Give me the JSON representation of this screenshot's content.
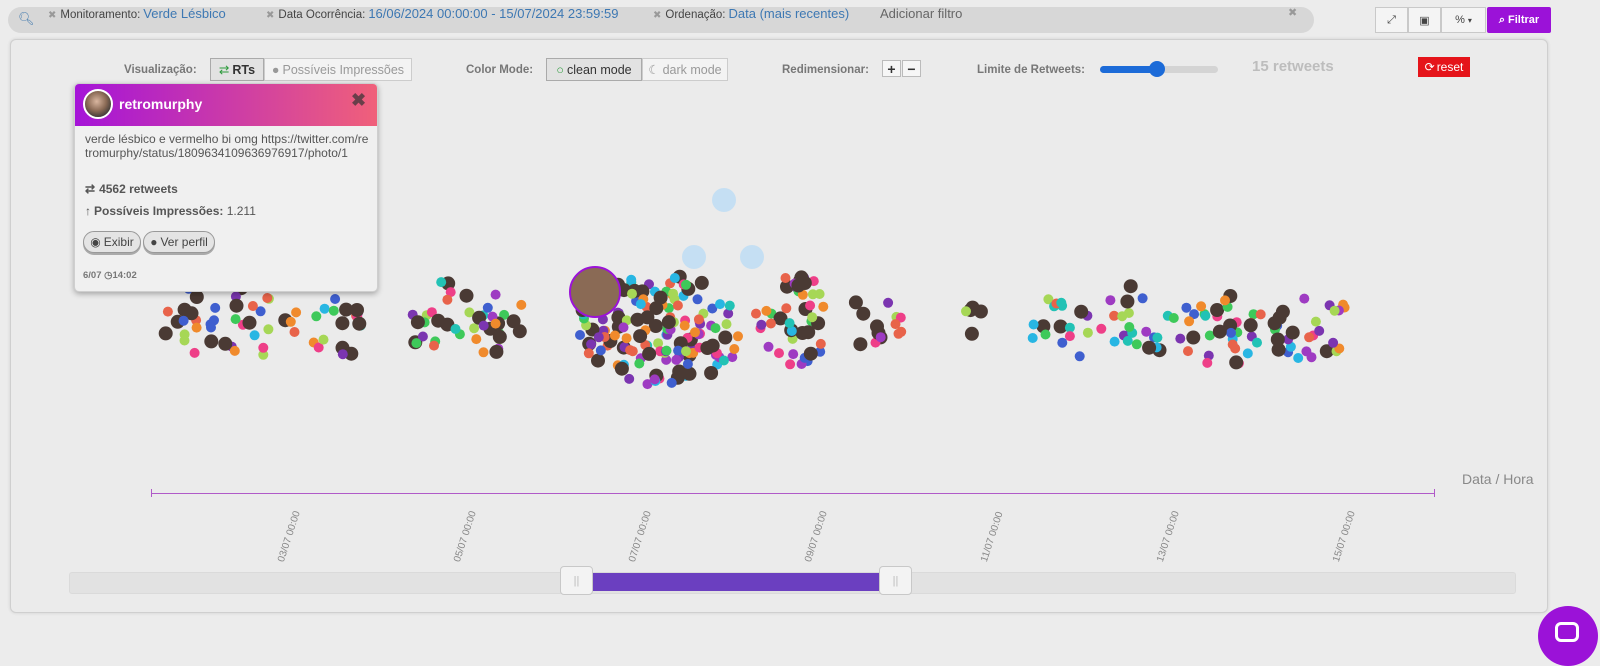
{
  "filters": {
    "search_icon": "search-icon",
    "chips": [
      {
        "label": "Monitoramento:",
        "value": "Verde Lésbico"
      },
      {
        "label": "Data Ocorrência:",
        "value": "16/06/2024 00:00:00 - 15/07/2024 23:59:59"
      },
      {
        "label": "Ordenação:",
        "value": "Data (mais recentes)"
      }
    ],
    "add_filter": "Adicionar filtro",
    "percent_label": "%",
    "filter_button": "Filtrar"
  },
  "controls": {
    "visualizacao_label": "Visualização:",
    "rts_label": "RTs",
    "impressoes_label": "Possíveis Impressões",
    "color_mode_label": "Color Mode:",
    "clean_mode": "clean mode",
    "dark_mode": "dark mode",
    "redimensionar_label": "Redimensionar:",
    "plus": "+",
    "minus": "−",
    "limite_label": "Limite de Retweets:",
    "limite_value_fraction": 0.5,
    "retweets_count": "15 retweets",
    "reset_label": "reset"
  },
  "popup": {
    "user": "retromurphy",
    "text": "verde lésbico e vermelho bi omg https://twitter.com/retromurphy/status/1809634109636976917/photo/1",
    "retweets": "4562 retweets",
    "impressoes_label": "Possíveis Impressões:",
    "impressoes_value": "1.211",
    "exibir": "Exibir",
    "ver_perfil": "Ver perfil",
    "date": "6/07",
    "time": "14:02"
  },
  "axis": {
    "label": "Data / Hora",
    "ticks": [
      "03/07 00:00",
      "05/07 00:00",
      "07/07 00:00",
      "09/07 00:00",
      "11/07 00:00",
      "13/07 00:00",
      "15/07 00:00"
    ]
  },
  "colors": {
    "accent": "#9b12d8",
    "reset": "#e5141a",
    "slider": "#1c6bd8",
    "range": "#6b3fc0",
    "bubble_palette": [
      "#7b35b0",
      "#e8634a",
      "#a6d756",
      "#22c2b5",
      "#3f5fcf",
      "#3ec95a",
      "#ee3f88",
      "#f08a2c",
      "#28b6e3",
      "#9e3bc2"
    ]
  }
}
